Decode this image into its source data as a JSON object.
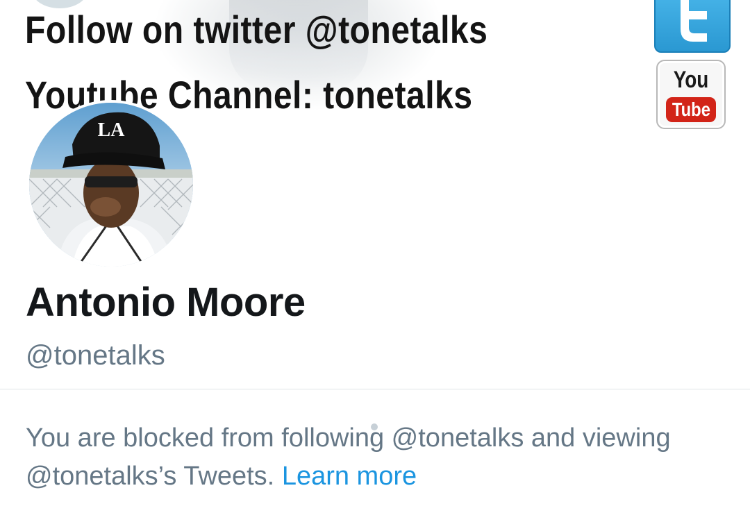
{
  "banner": {
    "line1": "Follow on twitter @tonetalks",
    "line2": "Youtube Channel: tonetalks",
    "youtube_logo": {
      "top": "You",
      "bottom": "Tube"
    }
  },
  "profile": {
    "name": "Antonio Moore",
    "handle": "@tonetalks"
  },
  "blocked": {
    "message": "You are blocked from following @tonetalks and viewing @tonetalks’s Tweets.",
    "learn_more": "Learn more"
  },
  "colors": {
    "link": "#1b95e0",
    "secondary_text": "#657786",
    "primary_text": "#14171a"
  },
  "icons": [
    "twitter-logo-icon",
    "youtube-logo-icon"
  ]
}
